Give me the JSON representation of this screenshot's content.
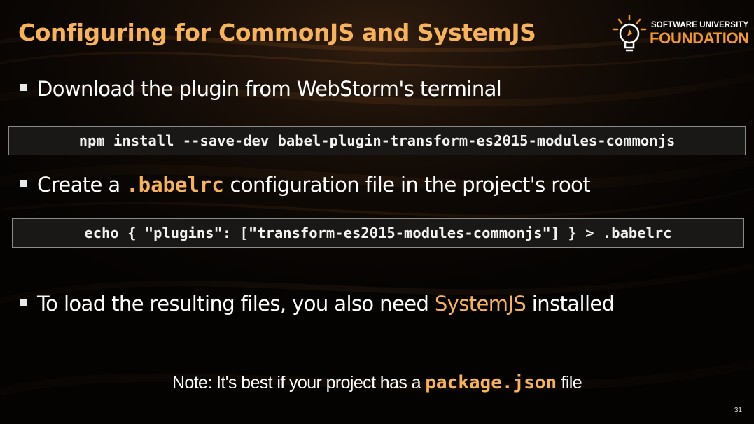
{
  "slide": {
    "title": "Configuring for CommonJS and SystemJS",
    "page_number": "31"
  },
  "logo": {
    "line1": "SOFTWARE UNIVERSITY",
    "line2": "FOUNDATION"
  },
  "bullets": [
    {
      "text": "Download the plugin from WebStorm's terminal"
    },
    {
      "before": "Create a ",
      "code": ".babelrc",
      "after": " configuration file in the project's root"
    },
    {
      "before": "To load the resulting files, you also need ",
      "highlight": "SystemJS",
      "after": " installed"
    }
  ],
  "code_blocks": [
    "npm install --save-dev babel-plugin-transform-es2015-modules-commonjs",
    "echo { \"plugins\": [\"transform-es2015-modules-commonjs\"] } > .babelrc"
  ],
  "note": {
    "before": "Note: It's best if your project has a ",
    "code": "package.json",
    "after": " file"
  },
  "colors": {
    "accent": "#f6b35a",
    "logo_orange": "#f39a2b",
    "background": "#050302",
    "text": "#ffffff"
  }
}
